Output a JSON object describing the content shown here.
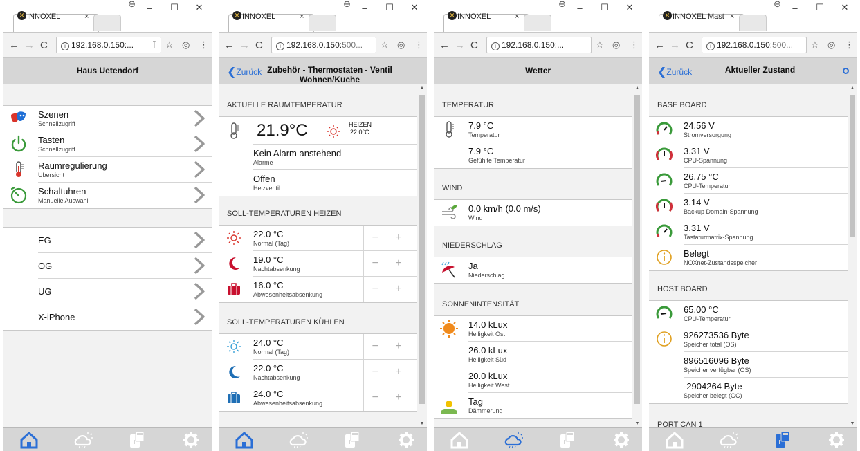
{
  "browser": {
    "back": "←",
    "fwd": "→",
    "reload": "C",
    "star": "☆",
    "menu": "⋮",
    "minimize": "–",
    "maximize": "☐",
    "close": "✕",
    "profile": "⊖",
    "tab_close": "×",
    "info": "i"
  },
  "windows": [
    {
      "tab_title": "INNOXEL",
      "url": "192.168.0.150:...",
      "url_port": "",
      "extra": "⍑",
      "header_title": "Haus Uetendorf",
      "back": "",
      "menu": [
        {
          "label": "Szenen",
          "sub": "Schnellzugriff",
          "icon": "masks"
        },
        {
          "label": "Tasten",
          "sub": "Schnellzugriff",
          "icon": "power"
        },
        {
          "label": "Raumregulierung",
          "sub": "Übersicht",
          "icon": "thermometer"
        },
        {
          "label": "Schaltuhren",
          "sub": "Manuelle Auswahl",
          "icon": "timer"
        }
      ],
      "floors": [
        {
          "label": "EG"
        },
        {
          "label": "OG"
        },
        {
          "label": "UG"
        },
        {
          "label": "X-iPhone"
        }
      ]
    },
    {
      "tab_title": "INNOXEL",
      "url": "192.168.0.150:",
      "url_port": "500...",
      "header_title": "Zubehör - Thermostaten - Ventil Wohnen/Kuche",
      "back": "Zurück",
      "sec_current": "AKTUELLE RAUMTEMPERATUR",
      "temp": "21.9°C",
      "heat_label": "HEIZEN",
      "heat_value": "22.0°C",
      "alarm_main": "Kein Alarm anstehend",
      "alarm_sub": "Alarme",
      "valve_main": "Offen",
      "valve_sub": "Heizventil",
      "sec_heat": "SOLL-TEMPERATUREN HEIZEN",
      "heat": [
        {
          "value": "22.0 °C",
          "label": "Normal (Tag)"
        },
        {
          "value": "19.0 °C",
          "label": "Nachtabsenkung"
        },
        {
          "value": "16.0 °C",
          "label": "Abwesenheitsabsenkung"
        }
      ],
      "sec_cool": "SOLL-TEMPERATUREN KÜHLEN",
      "cool": [
        {
          "value": "24.0 °C",
          "label": "Normal (Tag)"
        },
        {
          "value": "22.0 °C",
          "label": "Nachtabsenkung"
        },
        {
          "value": "24.0 °C",
          "label": "Abwesenheitsabsenkung"
        }
      ],
      "minus": "−",
      "plus": "+"
    },
    {
      "tab_title": "INNOXEL",
      "url": "192.168.0.150:...",
      "url_port": "",
      "header_title": "Wetter",
      "back": "",
      "sec_temp": "TEMPERATUR",
      "temp1": "7.9 °C",
      "temp1_sub": "Temperatur",
      "temp2": "7.9 °C",
      "temp2_sub": "Gefühlte Temperatur",
      "sec_wind": "WIND",
      "wind": "0.0 km/h (0.0 m/s)",
      "wind_sub": "Wind",
      "sec_rain": "NIEDERSCHLAG",
      "rain": "Ja",
      "rain_sub": "Niederschlag",
      "sec_sun": "SONNENINTENSITÄT",
      "sun": [
        {
          "value": "14.0 kLux",
          "label": "Helligkeit Ost"
        },
        {
          "value": "26.0 kLux",
          "label": "Helligkeit Süd"
        },
        {
          "value": "20.0 kLux",
          "label": "Helligkeit West"
        }
      ],
      "day": "Tag",
      "day_sub": "Dämmerung"
    },
    {
      "tab_title": "INNOXEL Mast",
      "url": "192.168.0.150:",
      "url_port": "500...",
      "header_title": "Aktueller Zustand",
      "back": "Zurück",
      "sec_base": "BASE BOARD",
      "base": [
        {
          "value": "24.56 V",
          "label": "Stromversorgung",
          "icon": "gauge-ok"
        },
        {
          "value": "3.31 V",
          "label": "CPU-Spannung",
          "icon": "gauge-low"
        },
        {
          "value": "26.75 °C",
          "label": "CPU-Temperatur",
          "icon": "gauge-mid"
        },
        {
          "value": "3.14 V",
          "label": "Backup Domain-Spannung",
          "icon": "gauge-low"
        },
        {
          "value": "3.31 V",
          "label": "Tastaturmatrix-Spannung",
          "icon": "gauge-ok"
        },
        {
          "value": "Belegt",
          "label": "NOXnet-Zustandsspeicher",
          "icon": "info"
        }
      ],
      "sec_host": "HOST BOARD",
      "host": [
        {
          "value": "65.00 °C",
          "label": "CPU-Temperatur",
          "icon": "gauge-mid"
        },
        {
          "value": "926273536 Byte",
          "label": "Speicher total (OS)",
          "icon": "info"
        },
        {
          "value": "896516096 Byte",
          "label": "Speicher verfügbar (OS)",
          "icon": ""
        },
        {
          "value": "-2904264 Byte",
          "label": "Speicher belegt (GC)",
          "icon": ""
        }
      ],
      "sec_port": "PORT CAN 1"
    }
  ],
  "colors": {
    "accent": "#2b6fd6",
    "header": "#d6d6d6",
    "gauge_green": "#3a9a3a",
    "gauge_red": "#d0303a",
    "info": "#e0a020",
    "heat": "#d9342b",
    "cool": "#3aa2d8",
    "night_red": "#c8102e",
    "night_blue": "#1f6fb5"
  }
}
